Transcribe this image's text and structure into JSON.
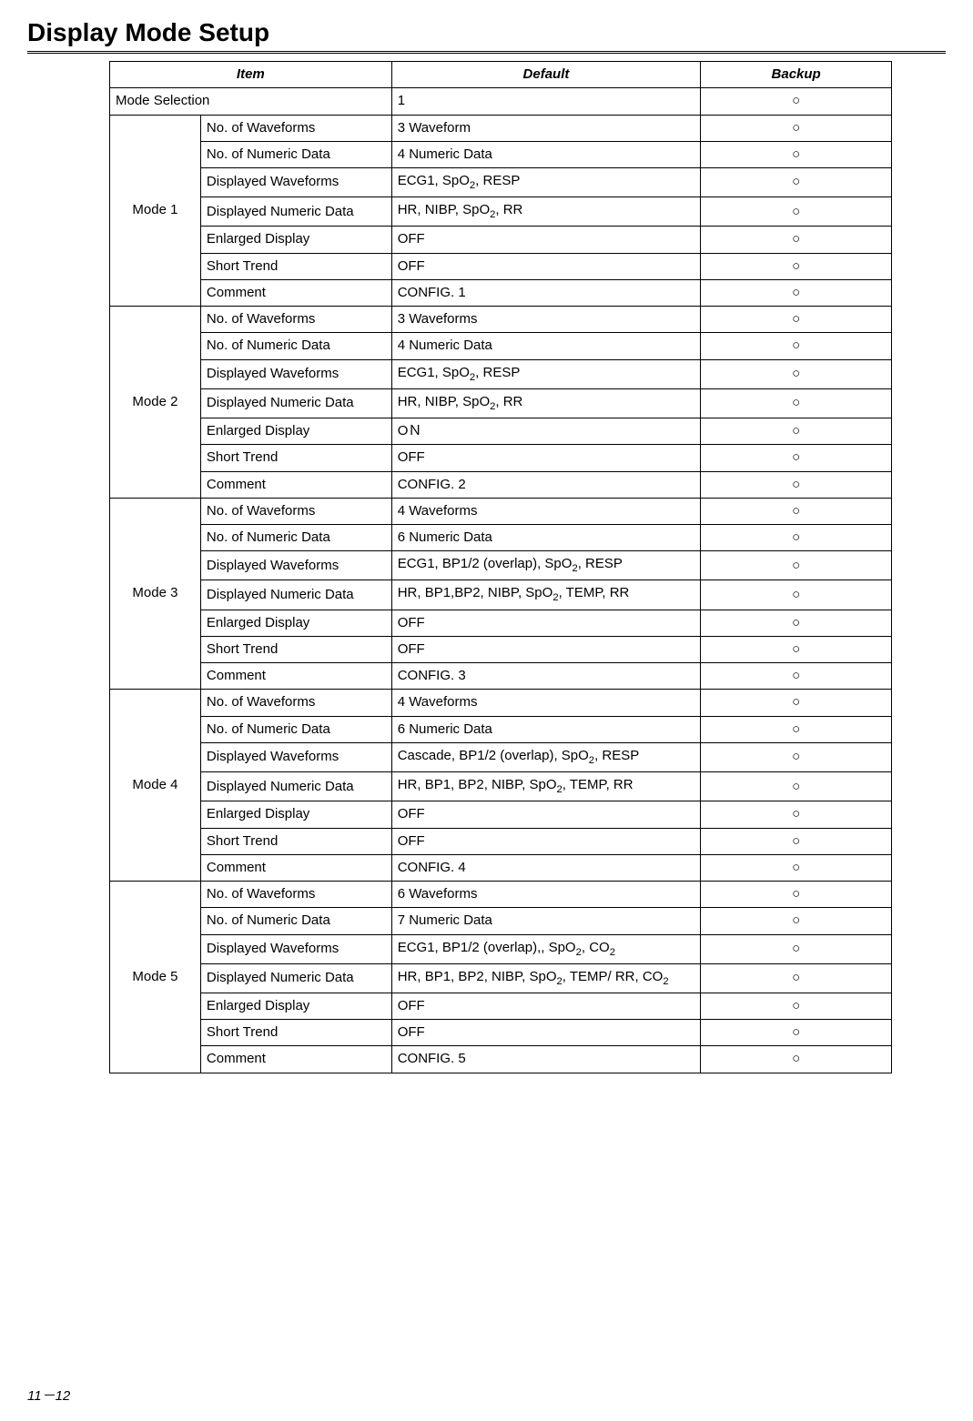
{
  "title": "Display Mode Setup",
  "headers": {
    "item": "Item",
    "default": "Default",
    "backup": "Backup"
  },
  "backup_mark": "○",
  "rows": [
    {
      "group": null,
      "groupspan": 2,
      "item": "Mode Selection",
      "default": "1"
    },
    {
      "group": "Mode 1",
      "rowspan": 7,
      "item": "No. of Waveforms",
      "default": "3 Waveform"
    },
    {
      "item": "No. of Numeric Data",
      "default": "4 Numeric Data"
    },
    {
      "item": "Displayed Waveforms",
      "default": "ECG1, SpO<sub>2</sub>, RESP"
    },
    {
      "item": "Displayed Numeric Data",
      "default": "HR, NIBP, SpO<sub>2</sub>, RR"
    },
    {
      "item": "Enlarged Display",
      "default": "OFF"
    },
    {
      "item": "Short Trend",
      "default": "OFF"
    },
    {
      "item": "Comment",
      "default": "CONFIG. 1"
    },
    {
      "group": "Mode 2",
      "rowspan": 7,
      "item": "No. of Waveforms",
      "default": "3 Waveforms"
    },
    {
      "item": "No. of Numeric Data",
      "default": "4 Numeric Data"
    },
    {
      "item": "Displayed Waveforms",
      "default": "ECG1, SpO<sub>2</sub>, RESP"
    },
    {
      "item": "Displayed Numeric Data",
      "default": "HR, NIBP, SpO<sub>2</sub>, RR"
    },
    {
      "item": "Enlarged Display",
      "default": "OＮ"
    },
    {
      "item": "Short Trend",
      "default": "OFF"
    },
    {
      "item": "Comment",
      "default": "CONFIG. 2"
    },
    {
      "group": "Mode 3",
      "rowspan": 7,
      "item": "No. of Waveforms",
      "default": "4 Waveforms"
    },
    {
      "item": "No. of Numeric Data",
      "default": "6 Numeric Data"
    },
    {
      "item": "Displayed Waveforms",
      "default": "ECG1, BP1/2 (overlap), SpO<sub>2</sub>, RESP"
    },
    {
      "item": "Displayed Numeric Data",
      "default": "HR, BP1,BP2, NIBP, SpO<sub>2</sub>, TEMP, RR"
    },
    {
      "item": "Enlarged Display",
      "default": "OFF"
    },
    {
      "item": "Short Trend",
      "default": "OFF"
    },
    {
      "item": "Comment",
      "default": "CONFIG. 3"
    },
    {
      "group": "Mode 4",
      "rowspan": 7,
      "item": "No. of Waveforms",
      "default": "4 Waveforms"
    },
    {
      "item": "No. of Numeric Data",
      "default": "6 Numeric Data"
    },
    {
      "item": "Displayed Waveforms",
      "default": "Cascade, BP1/2 (overlap), SpO<sub>2</sub>, RESP"
    },
    {
      "item": "Displayed Numeric Data",
      "default": "HR, BP1, BP2, NIBP, SpO<sub>2</sub>, TEMP, RR"
    },
    {
      "item": "Enlarged Display",
      "default": "OFF"
    },
    {
      "item": "Short Trend",
      "default": "OFF"
    },
    {
      "item": "Comment",
      "default": "CONFIG. 4"
    },
    {
      "group": "Mode 5",
      "rowspan": 7,
      "item": "No. of Waveforms",
      "default": "6 Waveforms"
    },
    {
      "item": "No. of Numeric Data",
      "default": "7 Numeric Data"
    },
    {
      "item": "Displayed Waveforms",
      "default": "ECG1, BP1/2 (overlap),, SpO<sub>2</sub>, CO<sub>2</sub>"
    },
    {
      "item": "Displayed Numeric Data",
      "default": "HR, BP1, BP2, NIBP, SpO<sub>2</sub>, TEMP/ RR, CO<sub>2</sub>"
    },
    {
      "item": "Enlarged Display",
      "default": "OFF"
    },
    {
      "item": "Short Trend",
      "default": "OFF"
    },
    {
      "item": "Comment",
      "default": "CONFIG. 5"
    }
  ],
  "page_number": "11－12"
}
